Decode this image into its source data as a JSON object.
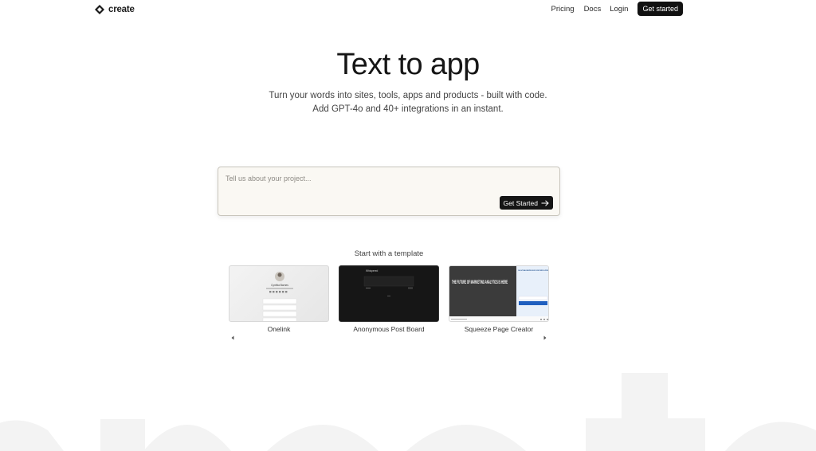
{
  "nav": {
    "logo_text": "create",
    "links": {
      "pricing": "Pricing",
      "docs": "Docs",
      "login": "Login"
    },
    "cta": "Get started"
  },
  "hero": {
    "title": "Text to app",
    "subtitle_line1": "Turn your words into sites, tools, apps and products - built with code.",
    "subtitle_line2": "Add GPT-4o and 40+ integrations in an instant."
  },
  "prompt": {
    "placeholder": "Tell us about your project...",
    "value": "",
    "submit_label": "Get Started"
  },
  "templates": {
    "heading": "Start with a template",
    "items": [
      {
        "label": "Onelink",
        "preview_name": "Cynthia Barnes"
      },
      {
        "label": "Anonymous Post Board",
        "preview_name": "Whispered"
      },
      {
        "label": "Squeeze Page Creator",
        "preview_headline": "THE FUTURE OF MARKETING ANALYTICS IS HERE",
        "preview_side": "CLEAR, ACTIONABLE MARKETING INSIGHTS ON ONE POWERFUL PLATFORM"
      }
    ]
  },
  "colors": {
    "background": "#ffffff",
    "primary_button": "#111111",
    "prompt_bg": "#faf8f3",
    "watermark": "#f2f2f2"
  },
  "icons": [
    "create-logo-icon",
    "arrow-right-icon",
    "chevron-left-icon",
    "chevron-right-icon"
  ]
}
